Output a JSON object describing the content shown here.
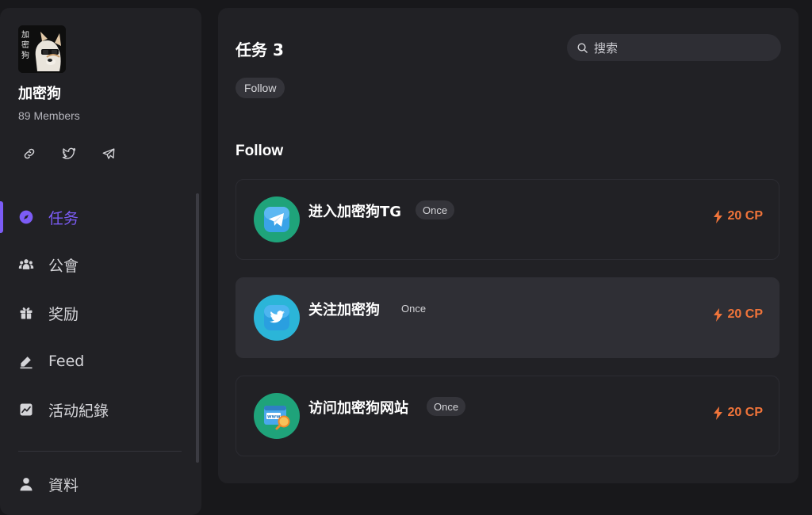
{
  "community": {
    "name": "加密狗",
    "members": "89 Members",
    "avatar_text": "加密狗"
  },
  "social_links": [
    {
      "icon": "link-icon"
    },
    {
      "icon": "twitter-icon"
    },
    {
      "icon": "telegram-icon"
    }
  ],
  "nav": {
    "items": [
      {
        "label": "任务",
        "icon": "compass-icon",
        "active": true
      },
      {
        "label": "公會",
        "icon": "users-icon",
        "active": false
      },
      {
        "label": "奖励",
        "icon": "gift-icon",
        "active": false
      },
      {
        "label": "Feed",
        "icon": "edit-icon",
        "active": false
      },
      {
        "label": "活动紀錄",
        "icon": "chart-icon",
        "active": false
      },
      {
        "label": "資料",
        "icon": "user-icon",
        "active": false
      }
    ]
  },
  "main": {
    "title": "任务 3",
    "search_placeholder": "搜索",
    "filter_chips": [
      "Follow"
    ],
    "section_title": "Follow",
    "tasks": [
      {
        "name": "进入加密狗TG",
        "frequency": "Once",
        "reward": "20 CP",
        "icon": "telegram-task-icon",
        "icon_bg": "#1fa37a"
      },
      {
        "name": "关注加密狗",
        "frequency": "Once",
        "reward": "20 CP",
        "icon": "twitter-task-icon",
        "icon_bg": "#2bb5d8"
      },
      {
        "name": "访问加密狗网站",
        "frequency": "Once",
        "reward": "20 CP",
        "icon": "website-task-icon",
        "icon_bg": "#1fa37a"
      }
    ]
  },
  "colors": {
    "accent": "#7c5cf6",
    "reward": "#f0743a",
    "background": "#18181b",
    "panel": "#212125"
  }
}
